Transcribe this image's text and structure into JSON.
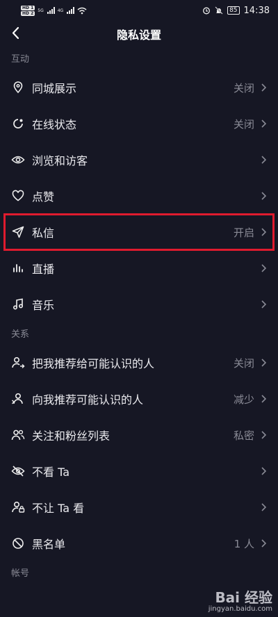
{
  "status": {
    "hd1": "HD 1",
    "hd2": "HD 2",
    "net1": "5G",
    "net2": "4G",
    "battery": "85",
    "time": "14:38"
  },
  "nav": {
    "title": "隐私设置"
  },
  "sections": {
    "interact": {
      "header": "互动",
      "items": [
        {
          "label": "同城展示",
          "value": "关闭",
          "icon": "location-pin-icon"
        },
        {
          "label": "在线状态",
          "value": "关闭",
          "icon": "online-status-icon"
        },
        {
          "label": "浏览和访客",
          "value": "",
          "icon": "eye-icon"
        },
        {
          "label": "点赞",
          "value": "",
          "icon": "heart-icon"
        },
        {
          "label": "私信",
          "value": "开启",
          "icon": "paper-plane-icon",
          "highlighted": true
        },
        {
          "label": "直播",
          "value": "",
          "icon": "live-bars-icon"
        },
        {
          "label": "音乐",
          "value": "",
          "icon": "music-note-icon"
        }
      ]
    },
    "relation": {
      "header": "关系",
      "items": [
        {
          "label": "把我推荐给可能认识的人",
          "value": "关闭",
          "icon": "user-share-icon"
        },
        {
          "label": "向我推荐可能认识的人",
          "value": "减少",
          "icon": "user-recommend-icon"
        },
        {
          "label": "关注和粉丝列表",
          "value": "私密",
          "icon": "users-icon"
        },
        {
          "label": "不看 Ta",
          "value": "",
          "icon": "eye-off-icon"
        },
        {
          "label": "不让 Ta 看",
          "value": "",
          "icon": "user-lock-icon"
        },
        {
          "label": "黑名单",
          "value": "1 人",
          "icon": "block-icon"
        }
      ]
    },
    "account": {
      "header": "帐号"
    }
  },
  "watermark": {
    "logo": "Bai 经验",
    "url": "jingyan.baidu.com"
  },
  "colors": {
    "background": "#161724",
    "highlight": "#e01b2e",
    "muted": "#8a8b96"
  }
}
